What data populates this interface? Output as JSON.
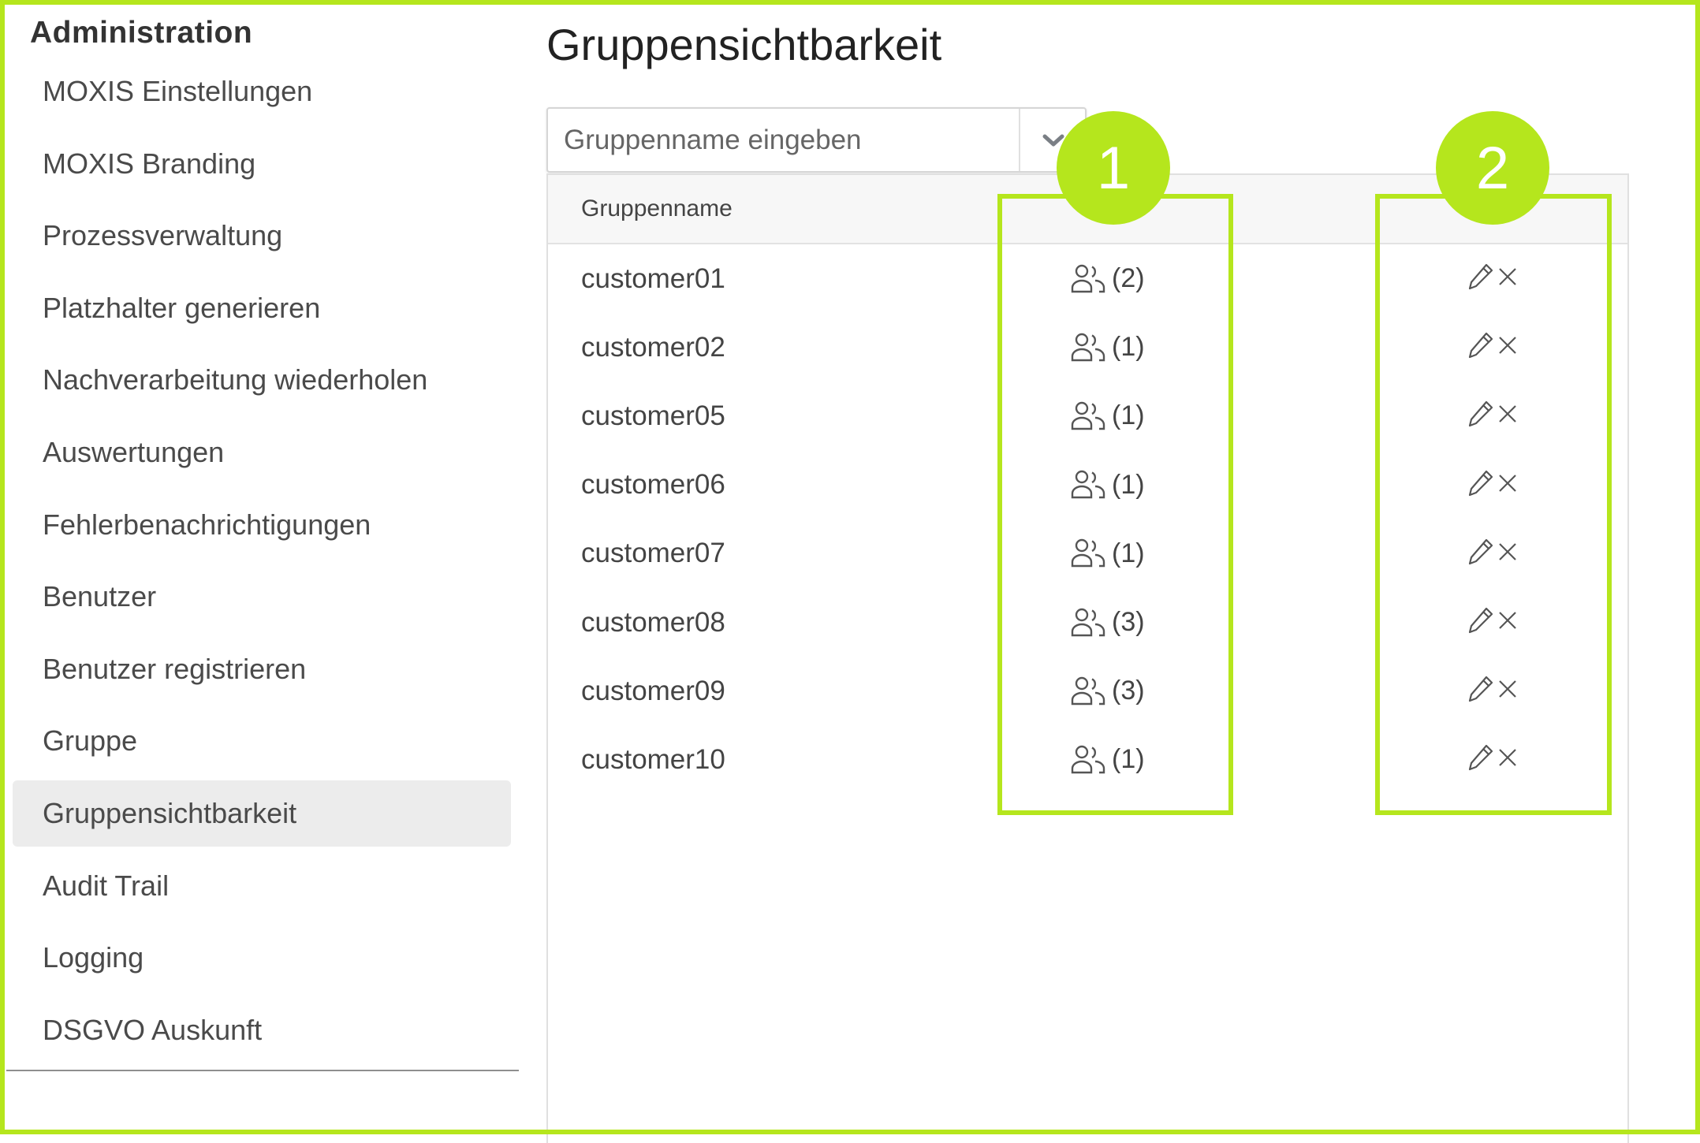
{
  "sidebar": {
    "title": "Administration",
    "items": [
      {
        "label": "MOXIS Einstellungen"
      },
      {
        "label": "MOXIS Branding"
      },
      {
        "label": "Prozessverwaltung"
      },
      {
        "label": "Platzhalter generieren"
      },
      {
        "label": "Nachverarbeitung wiederholen"
      },
      {
        "label": "Auswertungen"
      },
      {
        "label": "Fehlerbenachrichtigungen"
      },
      {
        "label": "Benutzer"
      },
      {
        "label": "Benutzer registrieren"
      },
      {
        "label": "Gruppe"
      },
      {
        "label": "Gruppensichtbarkeit",
        "active": true
      },
      {
        "label": "Audit Trail"
      },
      {
        "label": "Logging"
      },
      {
        "label": "DSGVO Auskunft"
      }
    ]
  },
  "main": {
    "title": "Gruppensichtbarkeit",
    "search": {
      "placeholder": "Gruppenname eingeben",
      "value": "",
      "toggle_icon": "chevron-down-icon"
    },
    "table": {
      "columns": [
        "Gruppenname",
        "",
        ""
      ],
      "rows": [
        {
          "name": "customer01",
          "members": "(2)"
        },
        {
          "name": "customer02",
          "members": "(1)"
        },
        {
          "name": "customer05",
          "members": "(1)"
        },
        {
          "name": "customer06",
          "members": "(1)"
        },
        {
          "name": "customer07",
          "members": "(1)"
        },
        {
          "name": "customer08",
          "members": "(3)"
        },
        {
          "name": "customer09",
          "members": "(3)"
        },
        {
          "name": "customer10",
          "members": "(1)"
        }
      ],
      "row_icons": {
        "members": "users-icon",
        "edit": "pencil-icon",
        "delete": "close-icon"
      }
    }
  },
  "annotations": {
    "color": "#b5e61d",
    "markers": [
      {
        "label": "1"
      },
      {
        "label": "2"
      }
    ]
  }
}
